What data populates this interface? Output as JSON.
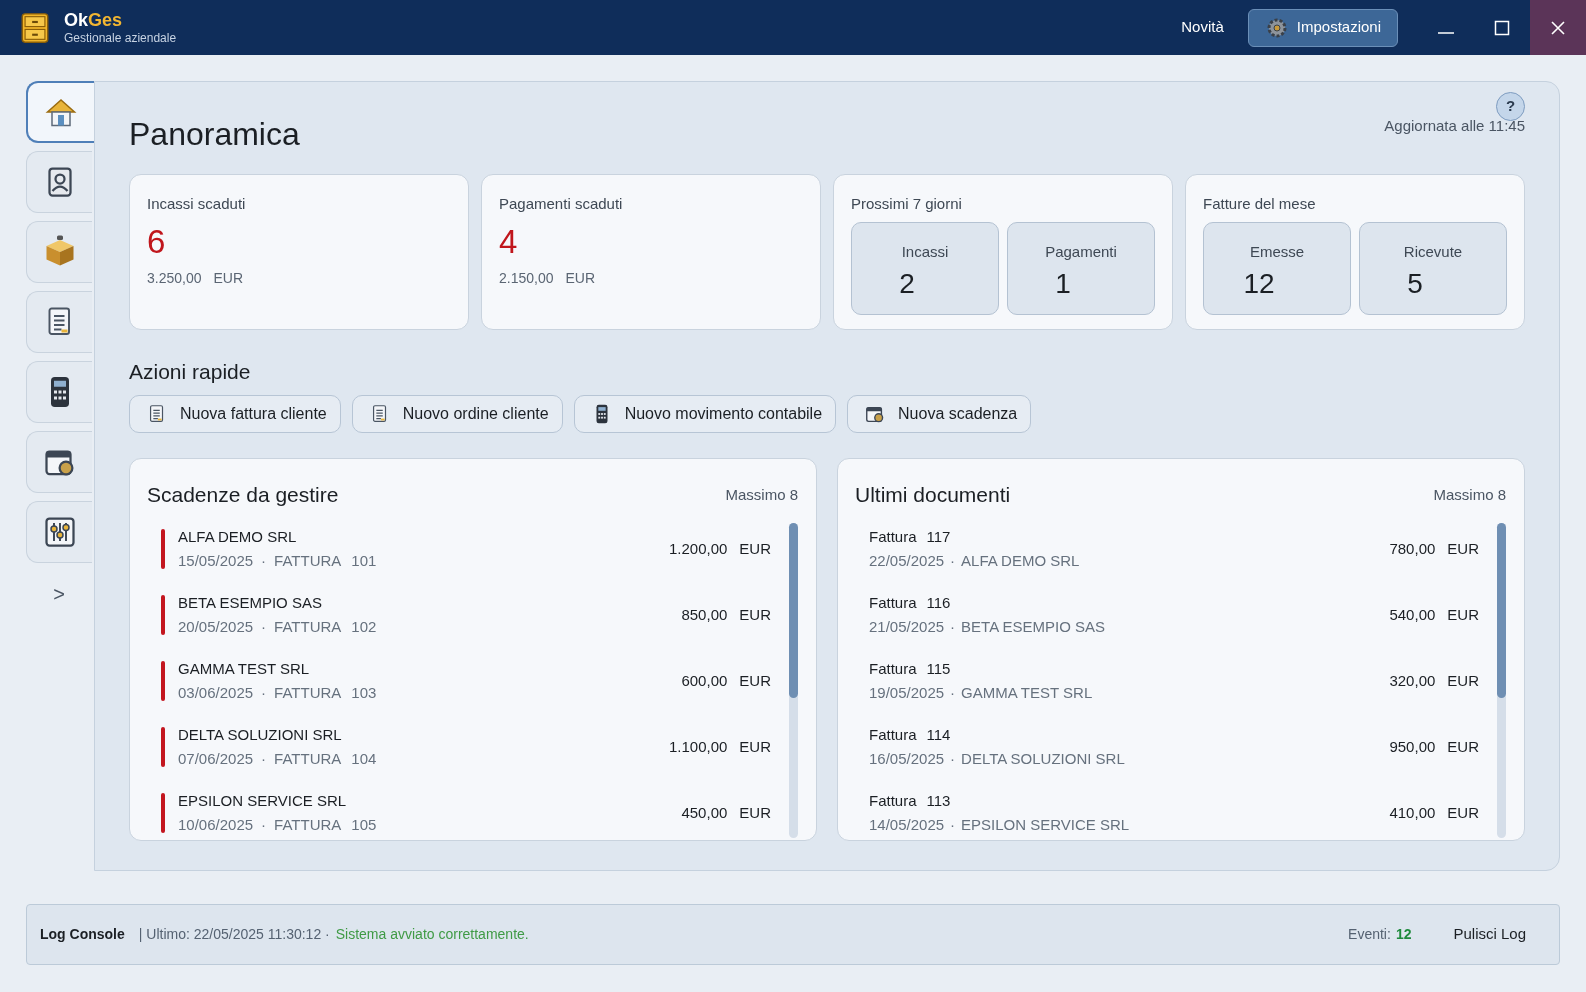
{
  "app": {
    "name_main": "Ok",
    "name_accent": "Ges",
    "subtitle": "Gestionale aziendale"
  },
  "header_actions": {
    "news": "Novità",
    "settings": "Impostazioni"
  },
  "sidebar": {
    "items": [
      {
        "selected": true
      },
      {
        "selected": false
      },
      {
        "selected": false
      },
      {
        "selected": false
      },
      {
        "selected": false
      },
      {
        "selected": false
      },
      {
        "selected": false
      }
    ],
    "expand": ">"
  },
  "page": {
    "title": "Panoramica",
    "updated": "Aggiornata alle 11:45",
    "help": "?"
  },
  "stat_cards": [
    {
      "kind": "single",
      "title": "Incassi scaduti",
      "count": "6",
      "amount": "3.250,00",
      "currency": "EUR"
    },
    {
      "kind": "single",
      "title": "Pagamenti scaduti",
      "count": "4",
      "amount": "2.150,00",
      "currency": "EUR"
    },
    {
      "kind": "pair",
      "title": "Prossimi 7 giorni",
      "tiles": [
        {
          "label": "Incassi",
          "value": "2"
        },
        {
          "label": "Pagamenti",
          "value": "1"
        }
      ]
    },
    {
      "kind": "pair",
      "title": "Fatture del mese",
      "tiles": [
        {
          "label": "Emesse",
          "value": "12"
        },
        {
          "label": "Ricevute",
          "value": "5"
        }
      ]
    }
  ],
  "quick_actions": {
    "title": "Azioni rapide",
    "buttons": [
      "Nuova fattura cliente",
      "Nuovo ordine cliente",
      "Nuovo movimento contabile",
      "Nuova scadenza"
    ]
  },
  "due_list": {
    "title": "Scadenze da gestire",
    "limit": "Massimo 8",
    "rows": [
      {
        "name": "ALFA DEMO SRL",
        "date": "15/05/2025",
        "separator": "·",
        "type": "FATTURA",
        "number": "101",
        "amount": "1.200,00",
        "currency": "EUR"
      },
      {
        "name": "BETA ESEMPIO SAS",
        "date": "20/05/2025",
        "separator": "·",
        "type": "FATTURA",
        "number": "102",
        "amount": "850,00",
        "currency": "EUR"
      },
      {
        "name": "GAMMA TEST SRL",
        "date": "03/06/2025",
        "separator": "·",
        "type": "FATTURA",
        "number": "103",
        "amount": "600,00",
        "currency": "EUR"
      },
      {
        "name": "DELTA SOLUZIONI SRL",
        "date": "07/06/2025",
        "separator": "·",
        "type": "FATTURA",
        "number": "104",
        "amount": "1.100,00",
        "currency": "EUR"
      },
      {
        "name": "EPSILON SERVICE SRL",
        "date": "10/06/2025",
        "separator": "·",
        "type": "FATTURA",
        "number": "105",
        "amount": "450,00",
        "currency": "EUR"
      }
    ]
  },
  "documents": {
    "title": "Ultimi documenti",
    "limit": "Massimo 8",
    "rows": [
      {
        "type": "Fattura",
        "number": "117",
        "date": "22/05/2025",
        "separator": "·",
        "customer": "ALFA DEMO SRL",
        "amount": "780,00",
        "currency": "EUR"
      },
      {
        "type": "Fattura",
        "number": "116",
        "date": "21/05/2025",
        "separator": "·",
        "customer": "BETA ESEMPIO SAS",
        "amount": "540,00",
        "currency": "EUR"
      },
      {
        "type": "Fattura",
        "number": "115",
        "date": "19/05/2025",
        "separator": "·",
        "customer": "GAMMA TEST SRL",
        "amount": "320,00",
        "currency": "EUR"
      },
      {
        "type": "Fattura",
        "number": "114",
        "date": "16/05/2025",
        "separator": "·",
        "customer": "DELTA SOLUZIONI SRL",
        "amount": "950,00",
        "currency": "EUR"
      },
      {
        "type": "Fattura",
        "number": "113",
        "date": "14/05/2025",
        "separator": "·",
        "customer": "EPSILON SERVICE SRL",
        "amount": "410,00",
        "currency": "EUR"
      }
    ]
  },
  "log_console": {
    "label": "Log Console",
    "last": "| Ultimo: 22/05/2025 11:30:12  ·",
    "message": "Sistema avviato correttamente.",
    "events_label": "Eventi:",
    "events_count": "12",
    "clear": "Pulisci Log"
  }
}
